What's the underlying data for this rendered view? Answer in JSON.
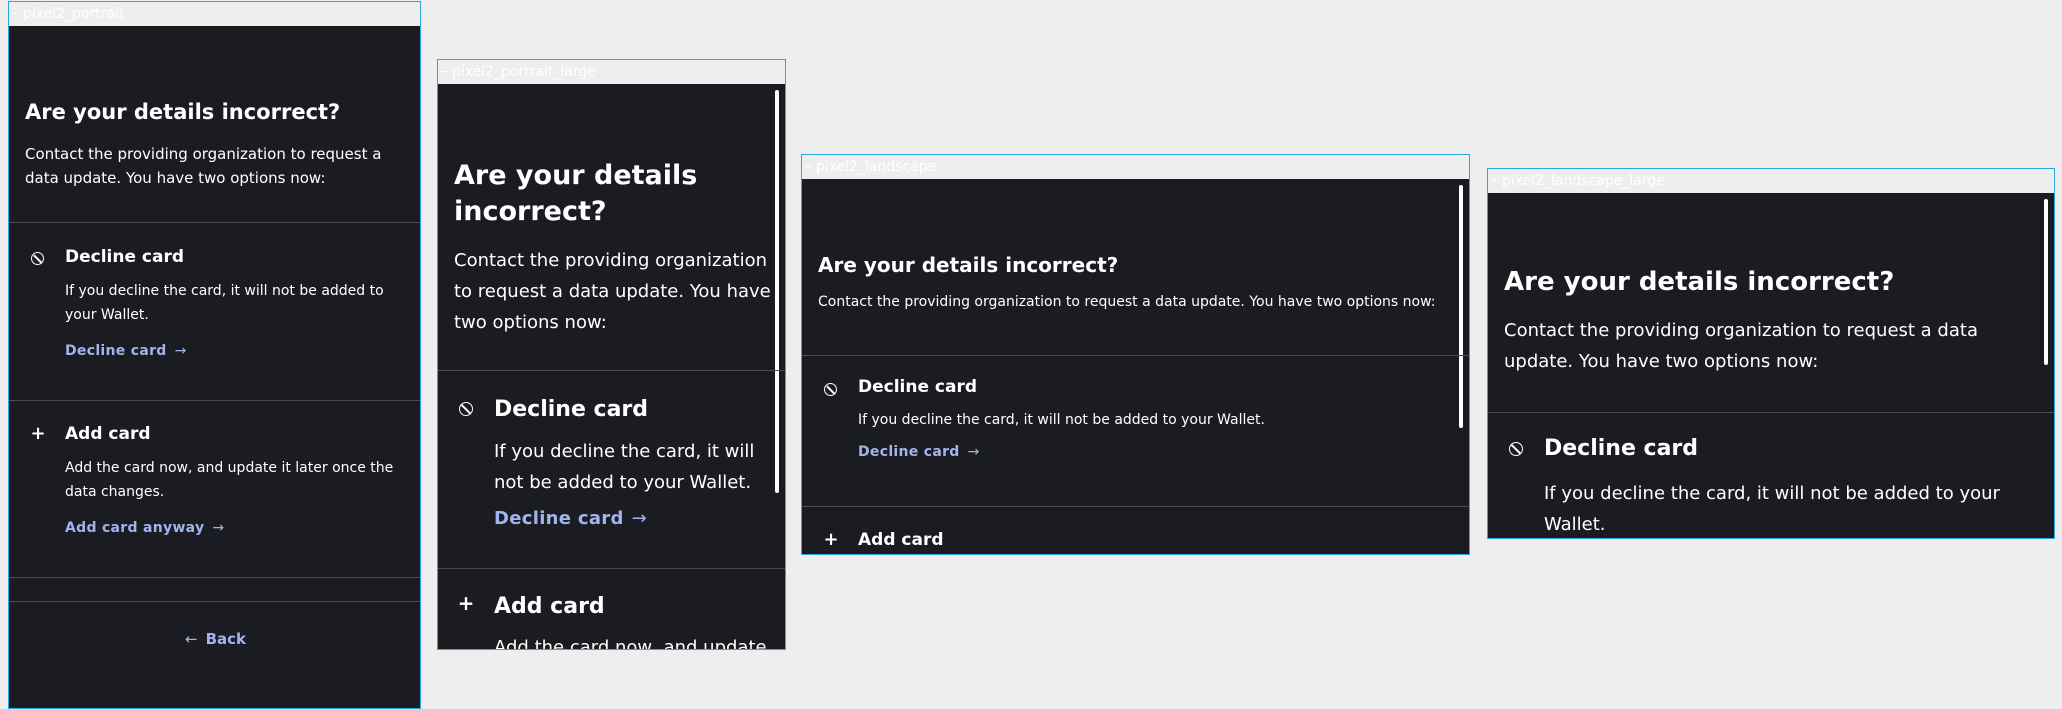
{
  "screens": [
    {
      "label": "pixel2_portrait"
    },
    {
      "label": "pixel2_portrait_large"
    },
    {
      "label": "pixel2_landscape"
    },
    {
      "label": "pixel2_landscape_large"
    }
  ],
  "content": {
    "title": "Are your details incorrect?",
    "intro": "Contact the providing organization to request a data update. You have two options now:",
    "options": [
      {
        "icon": "ban-icon",
        "title": "Decline card",
        "description": "If you decline the card, it will not be added to your Wallet.",
        "link": "Decline card"
      },
      {
        "icon": "plus-icon",
        "title": "Add card",
        "description": "Add the card now, and update it later once the data changes.",
        "link": "Add card anyway"
      }
    ],
    "back": "Back"
  },
  "colors": {
    "background": "#1b1c22",
    "link": "#a2b4ee",
    "frame_border": "#29a9e0",
    "canvas": "#eeeeee"
  }
}
